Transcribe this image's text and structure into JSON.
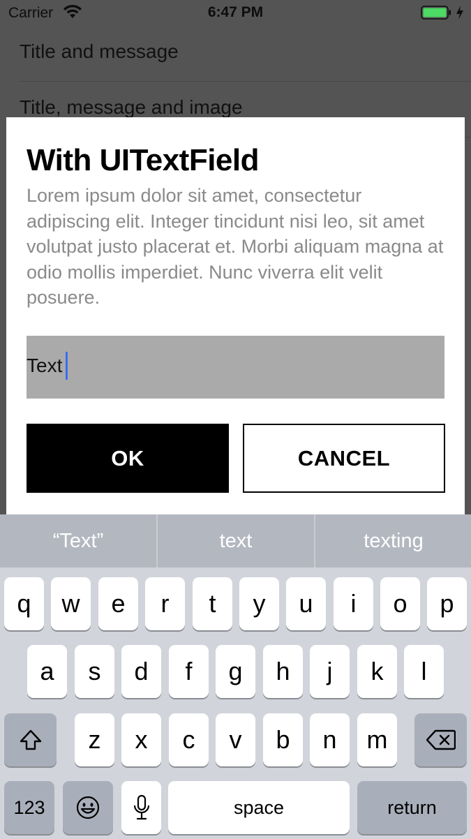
{
  "status_bar": {
    "carrier": "Carrier",
    "time": "6:47 PM"
  },
  "background_list": [
    "Title and message",
    "Title, message and image"
  ],
  "alert": {
    "title": "With UITextField",
    "message": "Lorem ipsum dolor sit amet, consectetur adipiscing elit. Integer tincidunt nisi leo, sit amet volutpat justo placerat et. Morbi aliquam magna at odio mollis imperdiet. Nunc viverra elit velit posuere.",
    "text_field_value": "Text",
    "ok_label": "OK",
    "cancel_label": "CANCEL"
  },
  "keyboard": {
    "suggestions": [
      "“Text”",
      "text",
      "texting"
    ],
    "row1": [
      "q",
      "w",
      "e",
      "r",
      "t",
      "y",
      "u",
      "i",
      "o",
      "p"
    ],
    "row2": [
      "a",
      "s",
      "d",
      "f",
      "g",
      "h",
      "j",
      "k",
      "l"
    ],
    "row3": [
      "z",
      "x",
      "c",
      "v",
      "b",
      "n",
      "m"
    ],
    "numbers_label": "123",
    "space_label": "space",
    "return_label": "return"
  },
  "colors": {
    "battery": "#4cd964",
    "caret": "#3b6cf5"
  }
}
